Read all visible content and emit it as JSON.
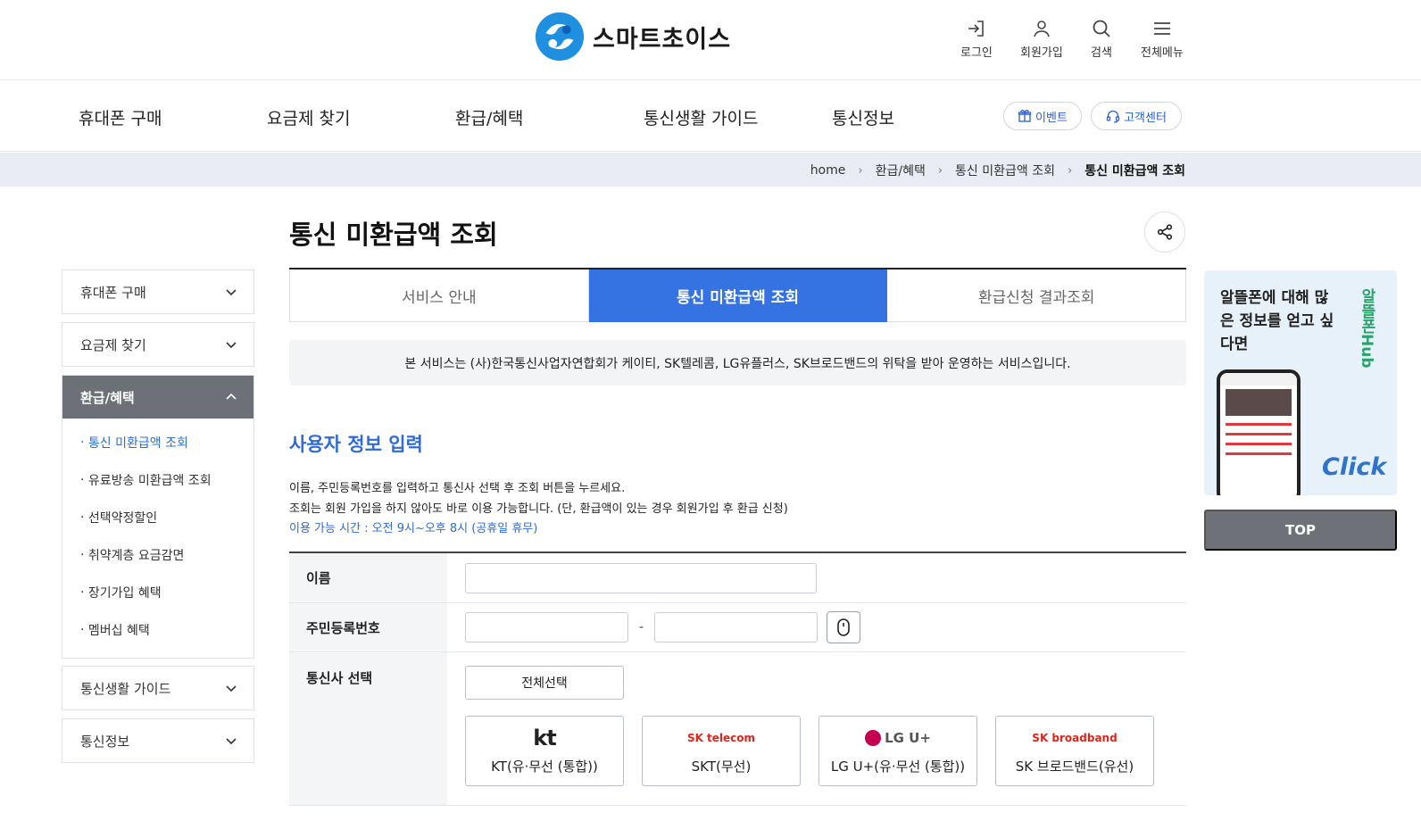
{
  "header": {
    "brand": "스마트초이스",
    "util": [
      {
        "label": "로그인",
        "icon": "login-icon"
      },
      {
        "label": "회원가입",
        "icon": "user-icon"
      },
      {
        "label": "검색",
        "icon": "search-icon"
      },
      {
        "label": "전체메뉴",
        "icon": "menu-icon"
      }
    ]
  },
  "gnb": {
    "items": [
      "휴대폰 구매",
      "요금제 찾기",
      "환급/혜택",
      "통신생활 가이드",
      "통신정보"
    ],
    "event_label": "이벤트",
    "support_label": "고객센터"
  },
  "breadcrumb": [
    "home",
    "환급/혜택",
    "통신 미환급액 조회",
    "통신 미환급액 조회"
  ],
  "sidebar": {
    "sections": [
      {
        "label": "휴대폰 구매"
      },
      {
        "label": "요금제 찾기"
      },
      {
        "label": "환급/혜택",
        "items": [
          "통신 미환급액 조회",
          "유료방송 미환급액 조회",
          "선택약정할인",
          "취약계층 요금감면",
          "장기가입 혜택",
          "멤버십 혜택"
        ]
      },
      {
        "label": "통신생활 가이드"
      },
      {
        "label": "통신정보"
      }
    ]
  },
  "main": {
    "title": "통신 미환급액 조회",
    "tabs": [
      "서비스 안내",
      "통신 미환급액 조회",
      "환급신청 결과조회"
    ],
    "active_tab": 1,
    "notice": "본 서비스는 (사)한국통신사업자연합회가 케이티, SK텔레콤, LG유플러스, SK브로드밴드의 위탁을 받아 운영하는 서비스입니다.",
    "section_title": "사용자 정보 입력",
    "desc": [
      "이름, 주민등록번호를 입력하고 통신사 선택 후 조회 버튼을 누르세요.",
      "조회는 회원 가입을 하지 않아도 바로 이용 가능합니다. (단, 환급액이 있는 경우 회원가입 후 환급 신청)"
    ],
    "hours": "이용 가능 시간 : 오전 9시~오후 8시 (공휴일 휴무)"
  },
  "form": {
    "name_label": "이름",
    "name_value": "",
    "rrn_label": "주민등록번호",
    "rrn_front": "",
    "rrn_back": "",
    "rrn_sep": "-",
    "carrier_label": "통신사 선택",
    "select_all": "전체선택",
    "carriers": [
      {
        "name": "KT(유·무선 (통합))",
        "logo_text": "kt"
      },
      {
        "name": "SKT(무선)",
        "logo_text": "SK telecom"
      },
      {
        "name": "LG U+(유·무선 (통합))",
        "logo_text": "LG U+"
      },
      {
        "name": "SK 브로드밴드(유선)",
        "logo_text": "SK broadband"
      }
    ]
  },
  "banner": {
    "text": "알뜰폰에 대해 많은 정보를 얻고 싶다면",
    "click": "Click",
    "vertical": "알뜰폰Hub"
  },
  "top_button": "TOP",
  "colors": {
    "accent": "#3572e2",
    "sub_accent": "#2f6bd6",
    "sidebar_active": "#6d7177",
    "breadcrumb_bg": "#e9edf3"
  }
}
